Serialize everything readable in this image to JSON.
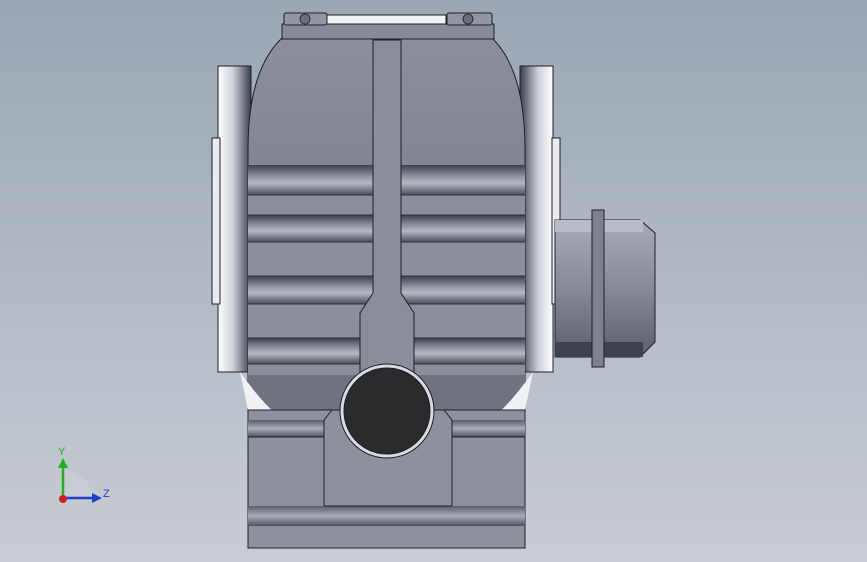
{
  "viewport": {
    "background_top": "#9aa6b2",
    "background_bottom": "#c9cdd4"
  },
  "model": {
    "name": "gearbox-front-view",
    "colors": {
      "body": "#7e8391",
      "body_dark": "#3f4350",
      "body_light": "#a9adb8",
      "highlight": "#f2f3f6",
      "bore": "#2b2b2e",
      "outline": "#1e2026"
    }
  },
  "triad": {
    "y_label": "Y",
    "z_label": "Z",
    "y_color": "#22b022",
    "z_color": "#1f3fd0",
    "x_color": "#d02020"
  }
}
